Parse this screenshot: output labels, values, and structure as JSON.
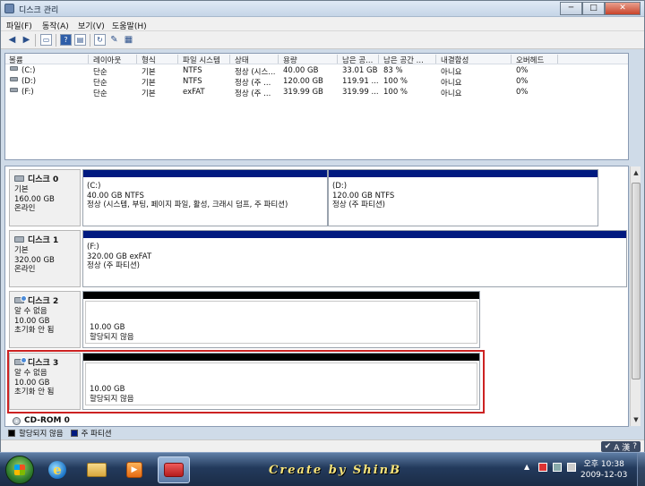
{
  "window": {
    "title": "디스크 관리",
    "min": "─",
    "max": "□",
    "close": "✕"
  },
  "menu": [
    "파일(F)",
    "동작(A)",
    "보기(V)",
    "도움말(H)"
  ],
  "volume_list": {
    "headers": [
      "볼륨",
      "레이아웃",
      "형식",
      "파일 시스템",
      "상태",
      "용량",
      "남은 공...",
      "남은 공간 ...",
      "내결함성",
      "오버헤드"
    ],
    "rows": [
      [
        "(C:)",
        "단순",
        "기본",
        "NTFS",
        "정상 (시스...",
        "40.00 GB",
        "33.01 GB",
        "83 %",
        "아니요",
        "0%"
      ],
      [
        "(D:)",
        "단순",
        "기본",
        "NTFS",
        "정상 (주 ...",
        "120.00 GB",
        "119.91 ...",
        "100 %",
        "아니요",
        "0%"
      ],
      [
        "(F:)",
        "단순",
        "기본",
        "exFAT",
        "정상 (주 ...",
        "319.99 GB",
        "319.99 ...",
        "100 %",
        "아니요",
        "0%"
      ]
    ]
  },
  "disks": [
    {
      "name": "디스크 0",
      "lines": [
        "기본",
        "160.00 GB",
        "온라인"
      ],
      "partitions": [
        {
          "label": "(C:)",
          "size": "40.00 GB NTFS",
          "status": "정상 (시스템, 부팅, 페이지 파일, 활성, 크래시 덤프, 주 파티션)"
        },
        {
          "label": "(D:)",
          "size": "120.00 GB NTFS",
          "status": "정상 (주 파티션)"
        }
      ]
    },
    {
      "name": "디스크 1",
      "lines": [
        "기본",
        "320.00 GB",
        "온라인"
      ],
      "partitions": [
        {
          "label": "(F:)",
          "size": "320.00 GB exFAT",
          "status": "정상 (주 파티션)"
        }
      ]
    },
    {
      "name": "디스크 2",
      "lines": [
        "알 수 없음",
        "10.00 GB",
        "초기화 안 됨"
      ],
      "partitions": [
        {
          "size": "10.00 GB",
          "status": "할당되지 않음"
        }
      ]
    },
    {
      "name": "디스크 3",
      "lines": [
        "알 수 없음",
        "10.00 GB",
        "초기화 안 됨"
      ],
      "partitions": [
        {
          "size": "10.00 GB",
          "status": "할당되지 않음"
        }
      ]
    }
  ],
  "cdrom": "CD-ROM 0",
  "legend": [
    "할당되지 않음",
    "주 파티션"
  ],
  "ime": "A 漢",
  "taskbar": {
    "brand": "Create by ShinB",
    "time": "오후 10:38",
    "date": "2009-12-03"
  },
  "colors": {
    "primary_partition": "#001a80",
    "unallocated": "#000000",
    "selection": "#cc2222"
  }
}
